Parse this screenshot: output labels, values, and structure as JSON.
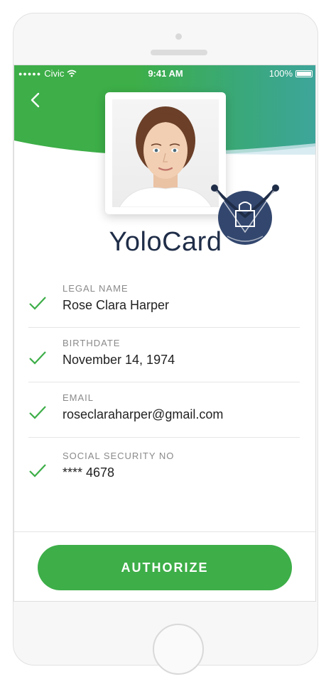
{
  "status_bar": {
    "carrier": "Civic",
    "time": "9:41 AM",
    "battery": "100%"
  },
  "brand": {
    "name": "YoloCard"
  },
  "fields": [
    {
      "label": "LEGAL NAME",
      "value": "Rose Clara Harper",
      "verified": true
    },
    {
      "label": "BIRTHDATE",
      "value": "November 14, 1974",
      "verified": true
    },
    {
      "label": "EMAIL",
      "value": "roseclaraharper@gmail.com",
      "verified": true
    },
    {
      "label": "SOCIAL SECURITY NO",
      "value": "**** 4678",
      "verified": true
    }
  ],
  "actions": {
    "authorize_label": "AUTHORIZE"
  },
  "colors": {
    "accent_green": "#3dae48",
    "header_teal": "#3ea59b",
    "brand_navy": "#1f2d48"
  },
  "icons": [
    "back-chevron-icon",
    "wifi-icon",
    "battery-icon",
    "check-icon",
    "seal-icon"
  ]
}
